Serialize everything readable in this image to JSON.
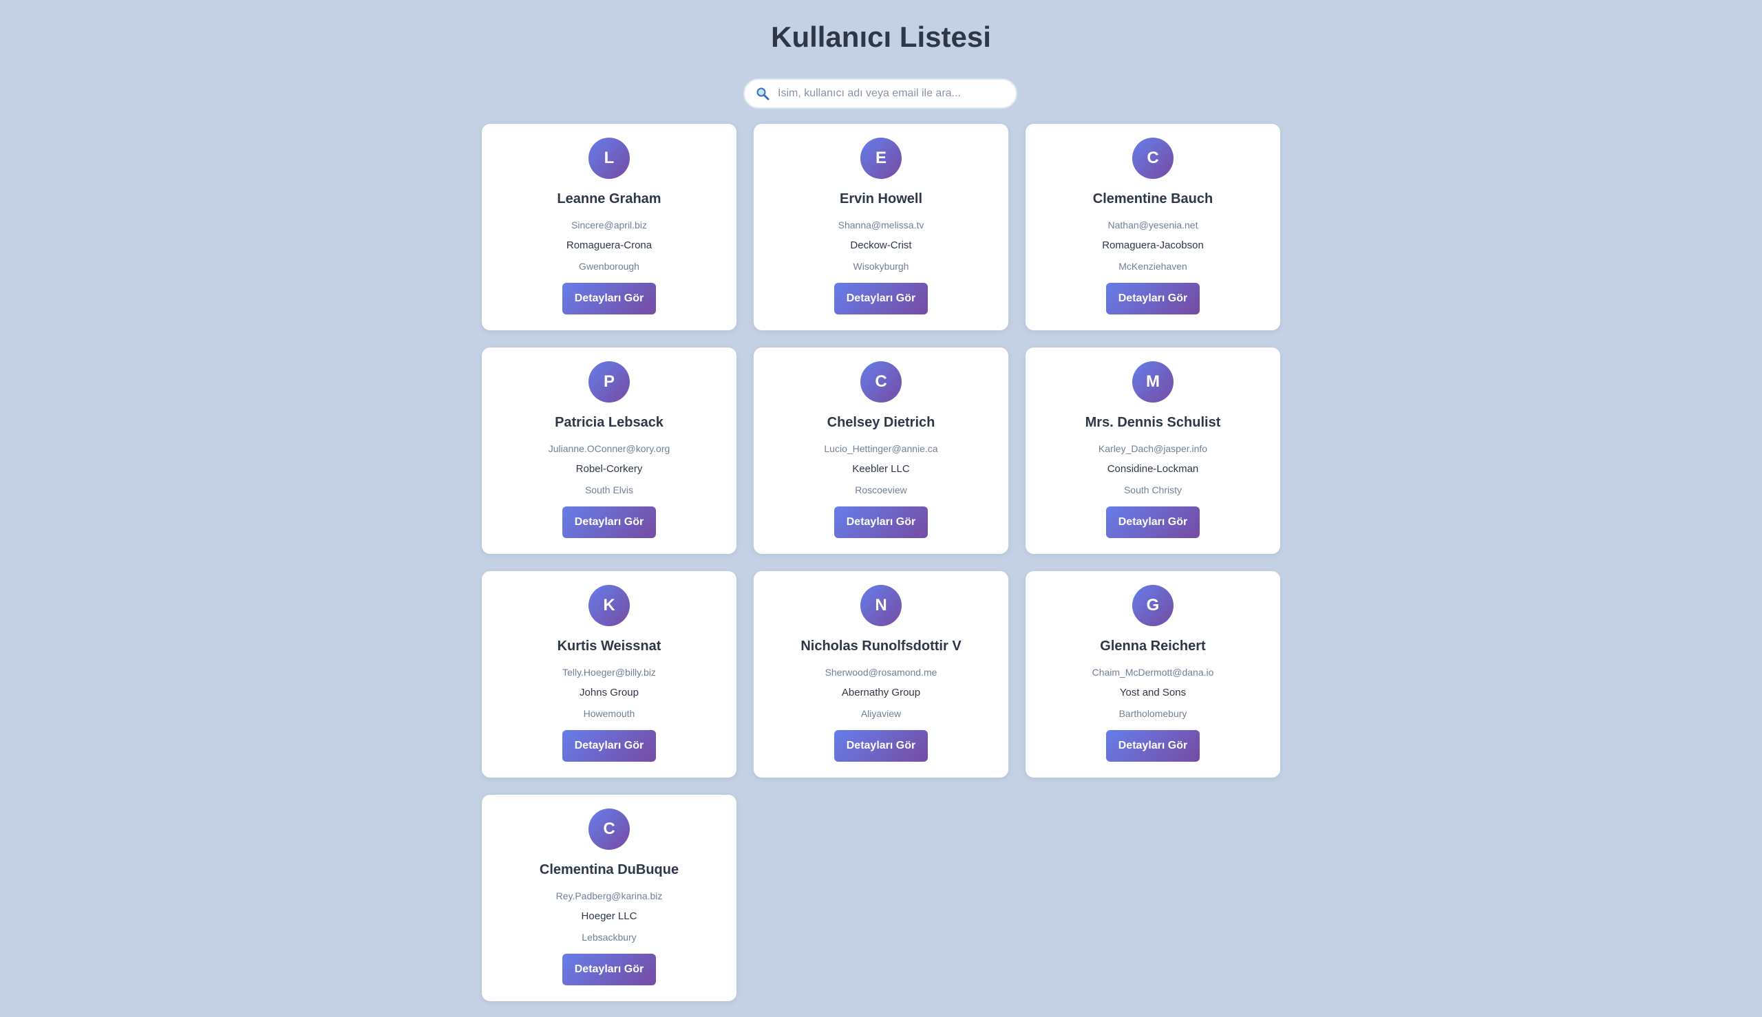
{
  "page": {
    "title": "Kullanıcı Listesi"
  },
  "search": {
    "placeholder": "İsim, kullanıcı adı veya email ile ara...",
    "icon": "magnifier-icon"
  },
  "colors": {
    "accent_start": "#667eea",
    "accent_end": "#764ba2",
    "background": "#c4d0e3"
  },
  "users": [
    {
      "initial": "L",
      "name": "Leanne Graham",
      "email": "Sincere@april.biz",
      "company": "Romaguera-Crona",
      "city": "Gwenborough",
      "button": "Detayları Gör"
    },
    {
      "initial": "E",
      "name": "Ervin Howell",
      "email": "Shanna@melissa.tv",
      "company": "Deckow-Crist",
      "city": "Wisokyburgh",
      "button": "Detayları Gör"
    },
    {
      "initial": "C",
      "name": "Clementine Bauch",
      "email": "Nathan@yesenia.net",
      "company": "Romaguera-Jacobson",
      "city": "McKenziehaven",
      "button": "Detayları Gör"
    },
    {
      "initial": "P",
      "name": "Patricia Lebsack",
      "email": "Julianne.OConner@kory.org",
      "company": "Robel-Corkery",
      "city": "South Elvis",
      "button": "Detayları Gör"
    },
    {
      "initial": "C",
      "name": "Chelsey Dietrich",
      "email": "Lucio_Hettinger@annie.ca",
      "company": "Keebler LLC",
      "city": "Roscoeview",
      "button": "Detayları Gör"
    },
    {
      "initial": "M",
      "name": "Mrs. Dennis Schulist",
      "email": "Karley_Dach@jasper.info",
      "company": "Considine-Lockman",
      "city": "South Christy",
      "button": "Detayları Gör"
    },
    {
      "initial": "K",
      "name": "Kurtis Weissnat",
      "email": "Telly.Hoeger@billy.biz",
      "company": "Johns Group",
      "city": "Howemouth",
      "button": "Detayları Gör"
    },
    {
      "initial": "N",
      "name": "Nicholas Runolfsdottir V",
      "email": "Sherwood@rosamond.me",
      "company": "Abernathy Group",
      "city": "Aliyaview",
      "button": "Detayları Gör"
    },
    {
      "initial": "G",
      "name": "Glenna Reichert",
      "email": "Chaim_McDermott@dana.io",
      "company": "Yost and Sons",
      "city": "Bartholomebury",
      "button": "Detayları Gör"
    },
    {
      "initial": "C",
      "name": "Clementina DuBuque",
      "email": "Rey.Padberg@karina.biz",
      "company": "Hoeger LLC",
      "city": "Lebsackbury",
      "button": "Detayları Gör"
    }
  ]
}
